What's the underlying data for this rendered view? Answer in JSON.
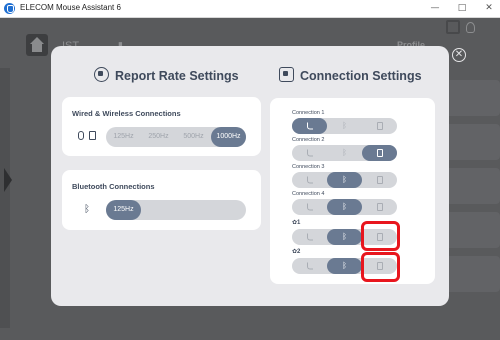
{
  "window": {
    "title": "ELECOM Mouse Assistant 6",
    "minimize_glyph": "—",
    "maximize_glyph": "□",
    "close_glyph": "✕"
  },
  "background": {
    "profile_label": "Profile",
    "mark_1": "IST",
    "mark_2": "▮"
  },
  "dialog": {
    "close_glyph": "✕",
    "report_rate": {
      "title": "Report Rate Settings",
      "wired_card": {
        "title": "Wired & Wireless Connections",
        "options": [
          "125Hz",
          "250Hz",
          "500Hz",
          "1000Hz"
        ],
        "selected": "1000Hz"
      },
      "bt_card": {
        "title": "Bluetooth Connections",
        "options": [
          "125Hz"
        ],
        "selected": "125Hz"
      }
    },
    "connection": {
      "title": "Connection Settings",
      "rows": [
        {
          "label": "Connection 1",
          "active": "wired"
        },
        {
          "label": "Connection 2",
          "active": "dongle"
        },
        {
          "label": "Connection 3",
          "active": "bluetooth"
        },
        {
          "label": "Connection 4",
          "active": "bluetooth"
        },
        {
          "label": "1",
          "active": "bluetooth",
          "gear": true,
          "highlighted": true
        },
        {
          "label": "2",
          "active": "bluetooth",
          "gear": true,
          "highlighted": true
        }
      ],
      "gear_glyph": "✿"
    }
  },
  "colors": {
    "accent": "#6a7a92",
    "highlight": "#e8161e",
    "dialog_bg": "#e9e9ec",
    "card_bg": "#ffffff",
    "pill_bg": "#d4d6da"
  },
  "icons": {
    "bluetooth": "ᛒ"
  }
}
